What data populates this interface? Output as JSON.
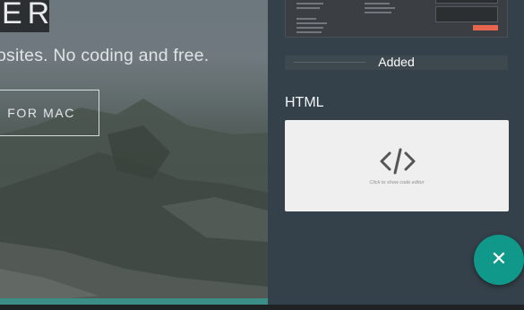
{
  "hero": {
    "logo_text": "ER",
    "tagline": "osites. No coding and free.",
    "download_button": "FOR MAC"
  },
  "panel": {
    "added_label": "Added",
    "section_title": "HTML",
    "code_block": {
      "icon": "code-icon",
      "hint": "Click to show code editor"
    }
  },
  "fab": {
    "icon": "close-icon",
    "glyph": "✕"
  },
  "colors": {
    "panel_bg": "#35414a",
    "fab_bg": "#10988a",
    "hero_bar": "#3c8f86",
    "send_button": "#e8664e"
  }
}
